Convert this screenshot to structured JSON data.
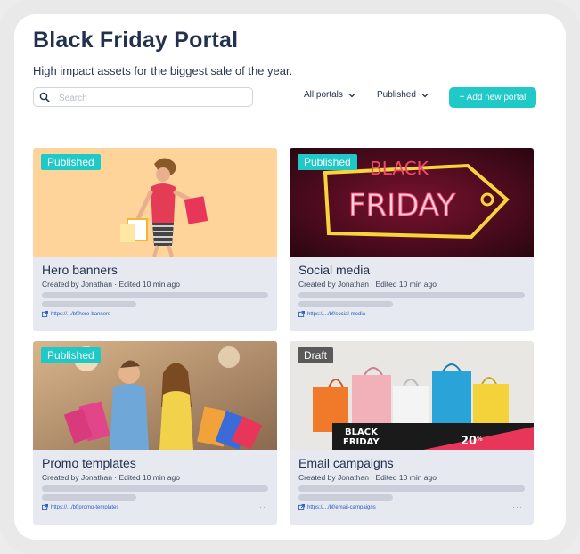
{
  "header": {
    "title": "Black Friday Portal",
    "subtitle": "High impact assets for the biggest sale of the year."
  },
  "toolbar": {
    "search_placeholder": "Search",
    "filter_portals": "All portals",
    "filter_status": "Published",
    "add_label": "+ Add new portal"
  },
  "cards": [
    {
      "status": "Published",
      "name": "Hero banners",
      "meta": "Created by Jonathan · Edited 10 min ago",
      "link": "https://.../bf/hero-banners",
      "more": "···"
    },
    {
      "status": "Published",
      "name": "Social media",
      "meta": "Created by Jonathan · Edited 10 min ago",
      "link": "https://.../bf/social-media",
      "more": "···",
      "image_text": [
        "BLACK",
        "FRIDAY"
      ]
    },
    {
      "status": "Published",
      "name": "Promo templates",
      "meta": "Created by Jonathan · Edited 10 min ago",
      "link": "https://.../bf/promo-templates",
      "more": "···"
    },
    {
      "status": "Draft",
      "name": "Email campaigns",
      "meta": "Created by Jonathan · Edited 10 min ago",
      "link": "https://.../bf/email-campaigns",
      "more": "···",
      "image_text": [
        "BLACK",
        "FRIDAY",
        "20",
        "%"
      ]
    }
  ],
  "colors": {
    "accent": "#1ec9c7",
    "title": "#23314f",
    "draft": "#5a5a5a",
    "link": "#2c5cc5"
  }
}
